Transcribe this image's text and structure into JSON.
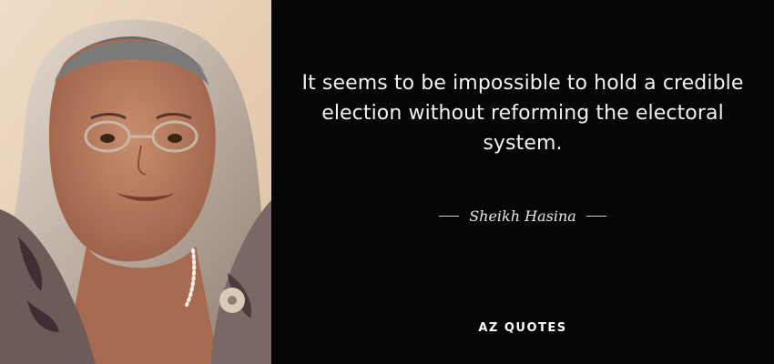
{
  "quote": {
    "text": "It seems to be impossible to hold a credible election without reforming the electoral system.",
    "author": "Sheikh Hasina"
  },
  "brand": {
    "logo_text": "AZ QUOTES"
  },
  "colors": {
    "background": "#050505",
    "quote_text": "#f2f2f2",
    "author_text": "#e8e8e8"
  }
}
